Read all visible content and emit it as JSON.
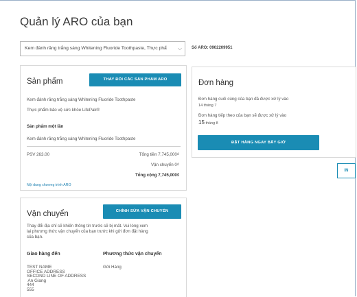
{
  "page": {
    "title": "Quản lý ARO của bạn"
  },
  "selector": {
    "value": "Kem đánh răng trắng sáng Whitening Fluoride Toothpaste, Thực phẩ"
  },
  "aro_number": "Số ARO: 0902209951",
  "product_card": {
    "title": "Sản phẩm",
    "change_button": "THAY ĐỔI CÁC SẢN PHẨM ARO",
    "items": [
      "Kem đánh răng trắng sáng Whitening Fluoride Toothpaste",
      "Thực phẩm bảo vệ sức khỏe LifePak®"
    ],
    "one_time_heading": "Sản phẩm một lần",
    "one_time_item": "Kem đánh răng trắng sáng Whitening Fluoride Toothpaste",
    "psv": "PSV 263.00",
    "subtotal": "Tổng tiền 7,745,000₫",
    "shipping": "Vận chuyển 0₫",
    "total": "Tổng cộng 7,745,000₫",
    "program_link": "Nội dung chương trình ARO"
  },
  "order_card": {
    "title": "Đơn hàng",
    "last_label": "Đơn hàng cuối cùng của bạn đã được xử lý vào",
    "last_date": "14 tháng 7",
    "next_label": "Đơn hàng tiếp theo của bạn sẽ được xử lý vào",
    "next_day": "15",
    "next_month": "tháng 8",
    "order_now_button": "ĐẶT HÀNG NGAY BÂY GIỜ"
  },
  "print_button": "IN",
  "shipping_card": {
    "title": "Vận chuyển",
    "edit_button": "CHỈNH SỬA VẬN CHUYỂN",
    "note": [
      "Thay đổi địa chỉ sẽ khiến thông tin trước sẽ bị mất. Vui lòng xem",
      "lại phương thức vận chuyển của bạn trước khi gửi đơn đặt hàng",
      "của bạn."
    ],
    "deliver_to_heading": "Giao hàng đến",
    "method_heading": "Phương thức vận chuyển",
    "method_value": "Gửi Hàng",
    "address": [
      "TEST NAME",
      "OFFICE ADDRESS",
      "SECOND LINE OF ADDRESS",
      " An Giang",
      "444",
      "555"
    ]
  }
}
